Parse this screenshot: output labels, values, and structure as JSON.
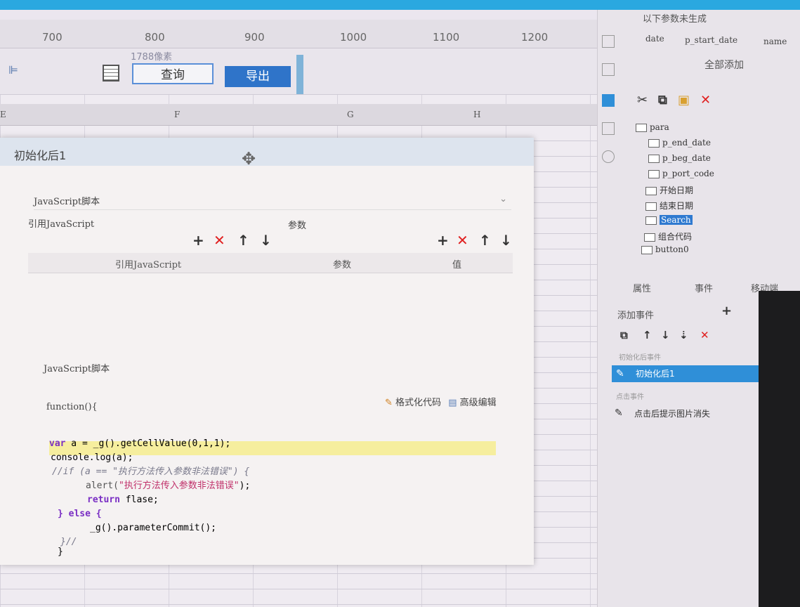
{
  "ruler": {
    "ticks": [
      "700",
      "800",
      "900",
      "1000",
      "1100",
      "1200"
    ]
  },
  "toolbar": {
    "size_hint": "1788像素",
    "query_label": "查询",
    "export_label": "导出"
  },
  "columns": [
    "E",
    "F",
    "G",
    "H"
  ],
  "dialog": {
    "title": "初始化后1",
    "script_select": "JavaScript脚本",
    "ref_label": "引用JavaScript",
    "params_label": "参数",
    "table_headers": [
      "引用JavaScript",
      "参数",
      "值"
    ],
    "js_label": "JavaScript脚本",
    "function_label": "function(){",
    "format_code": "格式化代码",
    "advanced_edit": "高级编辑",
    "code": {
      "l1_kw": "var",
      "l1_rest": " a = _g().getCellValue(0,1,1);",
      "l2": "console.log(a);",
      "l3_cmt": "//if (a == \"执行方法传入参数非法错误\") {",
      "l4_fn": "alert(",
      "l4_str": "\"执行方法传入参数非法错误\"",
      "l4_end": ");",
      "l5_kw": "return",
      "l5_rest": " flase;",
      "l6_kw": "} else {",
      "l7": "_g().parameterCommit();",
      "l8": "}//",
      "l9": "}"
    }
  },
  "right_panel": {
    "notice": "以下参数未生成",
    "params": [
      "date",
      "p_start_date",
      "name"
    ],
    "add_all": "全部添加",
    "tree": [
      "para",
      "p_end_date",
      "p_beg_date",
      "p_port_code",
      "开始日期",
      "结束日期",
      "Search",
      "组合代码",
      "button0"
    ],
    "tabs": [
      "属性",
      "事件",
      "移动端"
    ],
    "add_event": "添加事件",
    "group1": "初始化后事件",
    "event1": "初始化后1",
    "group2": "点击事件",
    "event2": "点击后提示图片消失"
  }
}
